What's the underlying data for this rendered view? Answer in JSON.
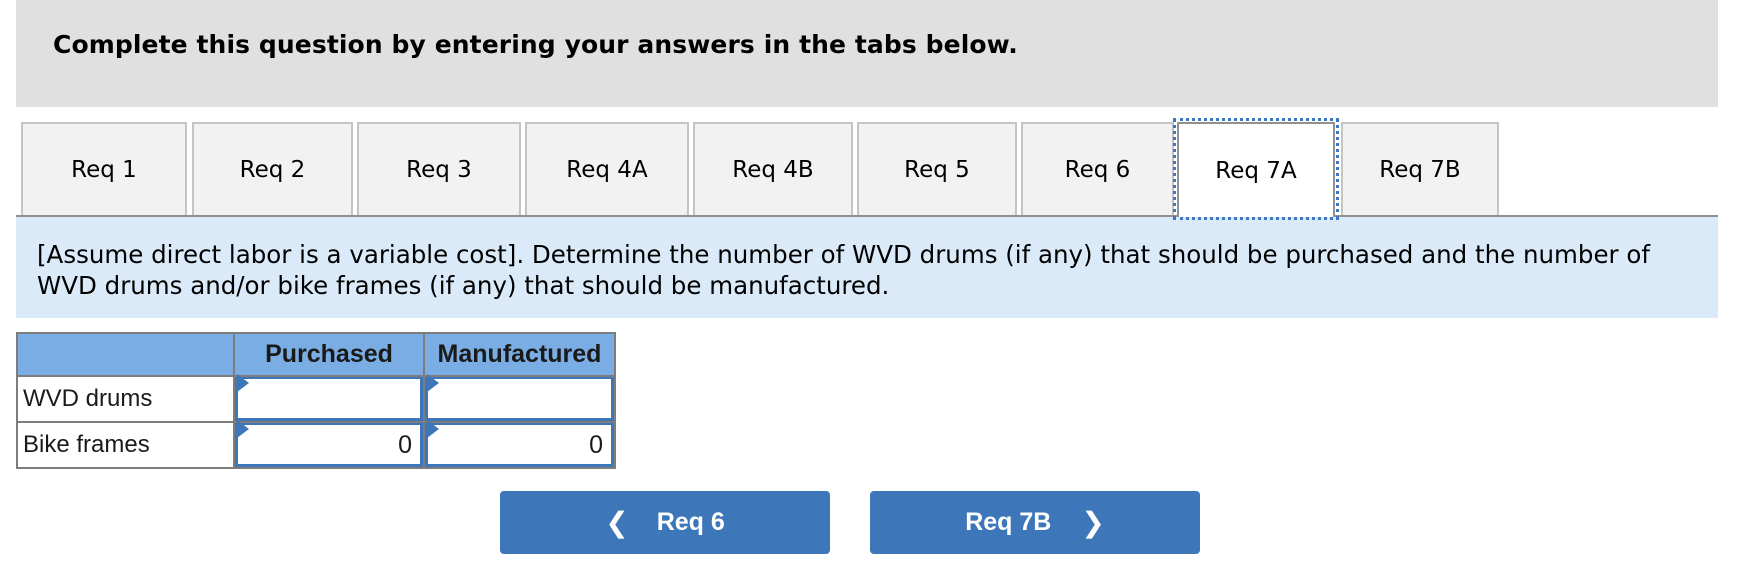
{
  "header": {
    "title": "Complete this question by entering your answers in the tabs below."
  },
  "tabs": [
    {
      "label": "Req 1",
      "active": false
    },
    {
      "label": "Req 2",
      "active": false
    },
    {
      "label": "Req 3",
      "active": false
    },
    {
      "label": "Req 4A",
      "active": false
    },
    {
      "label": "Req 4B",
      "active": false
    },
    {
      "label": "Req 5",
      "active": false
    },
    {
      "label": "Req 6",
      "active": false
    },
    {
      "label": "Req 7A",
      "active": true
    },
    {
      "label": "Req 7B",
      "active": false
    }
  ],
  "instructions": "[Assume direct labor is a variable cost]. Determine the number of WVD drums (if any) that should be purchased and the number of WVD drums and/or bike frames (if any) that should be manufactured.",
  "table": {
    "columns": [
      "",
      "Purchased",
      "Manufactured"
    ],
    "rows": [
      {
        "label": "WVD drums",
        "purchased": "",
        "manufactured": ""
      },
      {
        "label": "Bike frames",
        "purchased": "0",
        "manufactured": "0"
      }
    ]
  },
  "nav": {
    "prev": {
      "label": "Req 6",
      "icon": "chevron-left-icon",
      "glyph": "❮"
    },
    "next": {
      "label": "Req 7B",
      "icon": "chevron-right-icon",
      "glyph": "❯"
    }
  },
  "colors": {
    "header_bg": "#e0e0e0",
    "instructions_bg": "#daeaf8",
    "table_header_bg": "#7aade4",
    "accent": "#3d77b9"
  }
}
